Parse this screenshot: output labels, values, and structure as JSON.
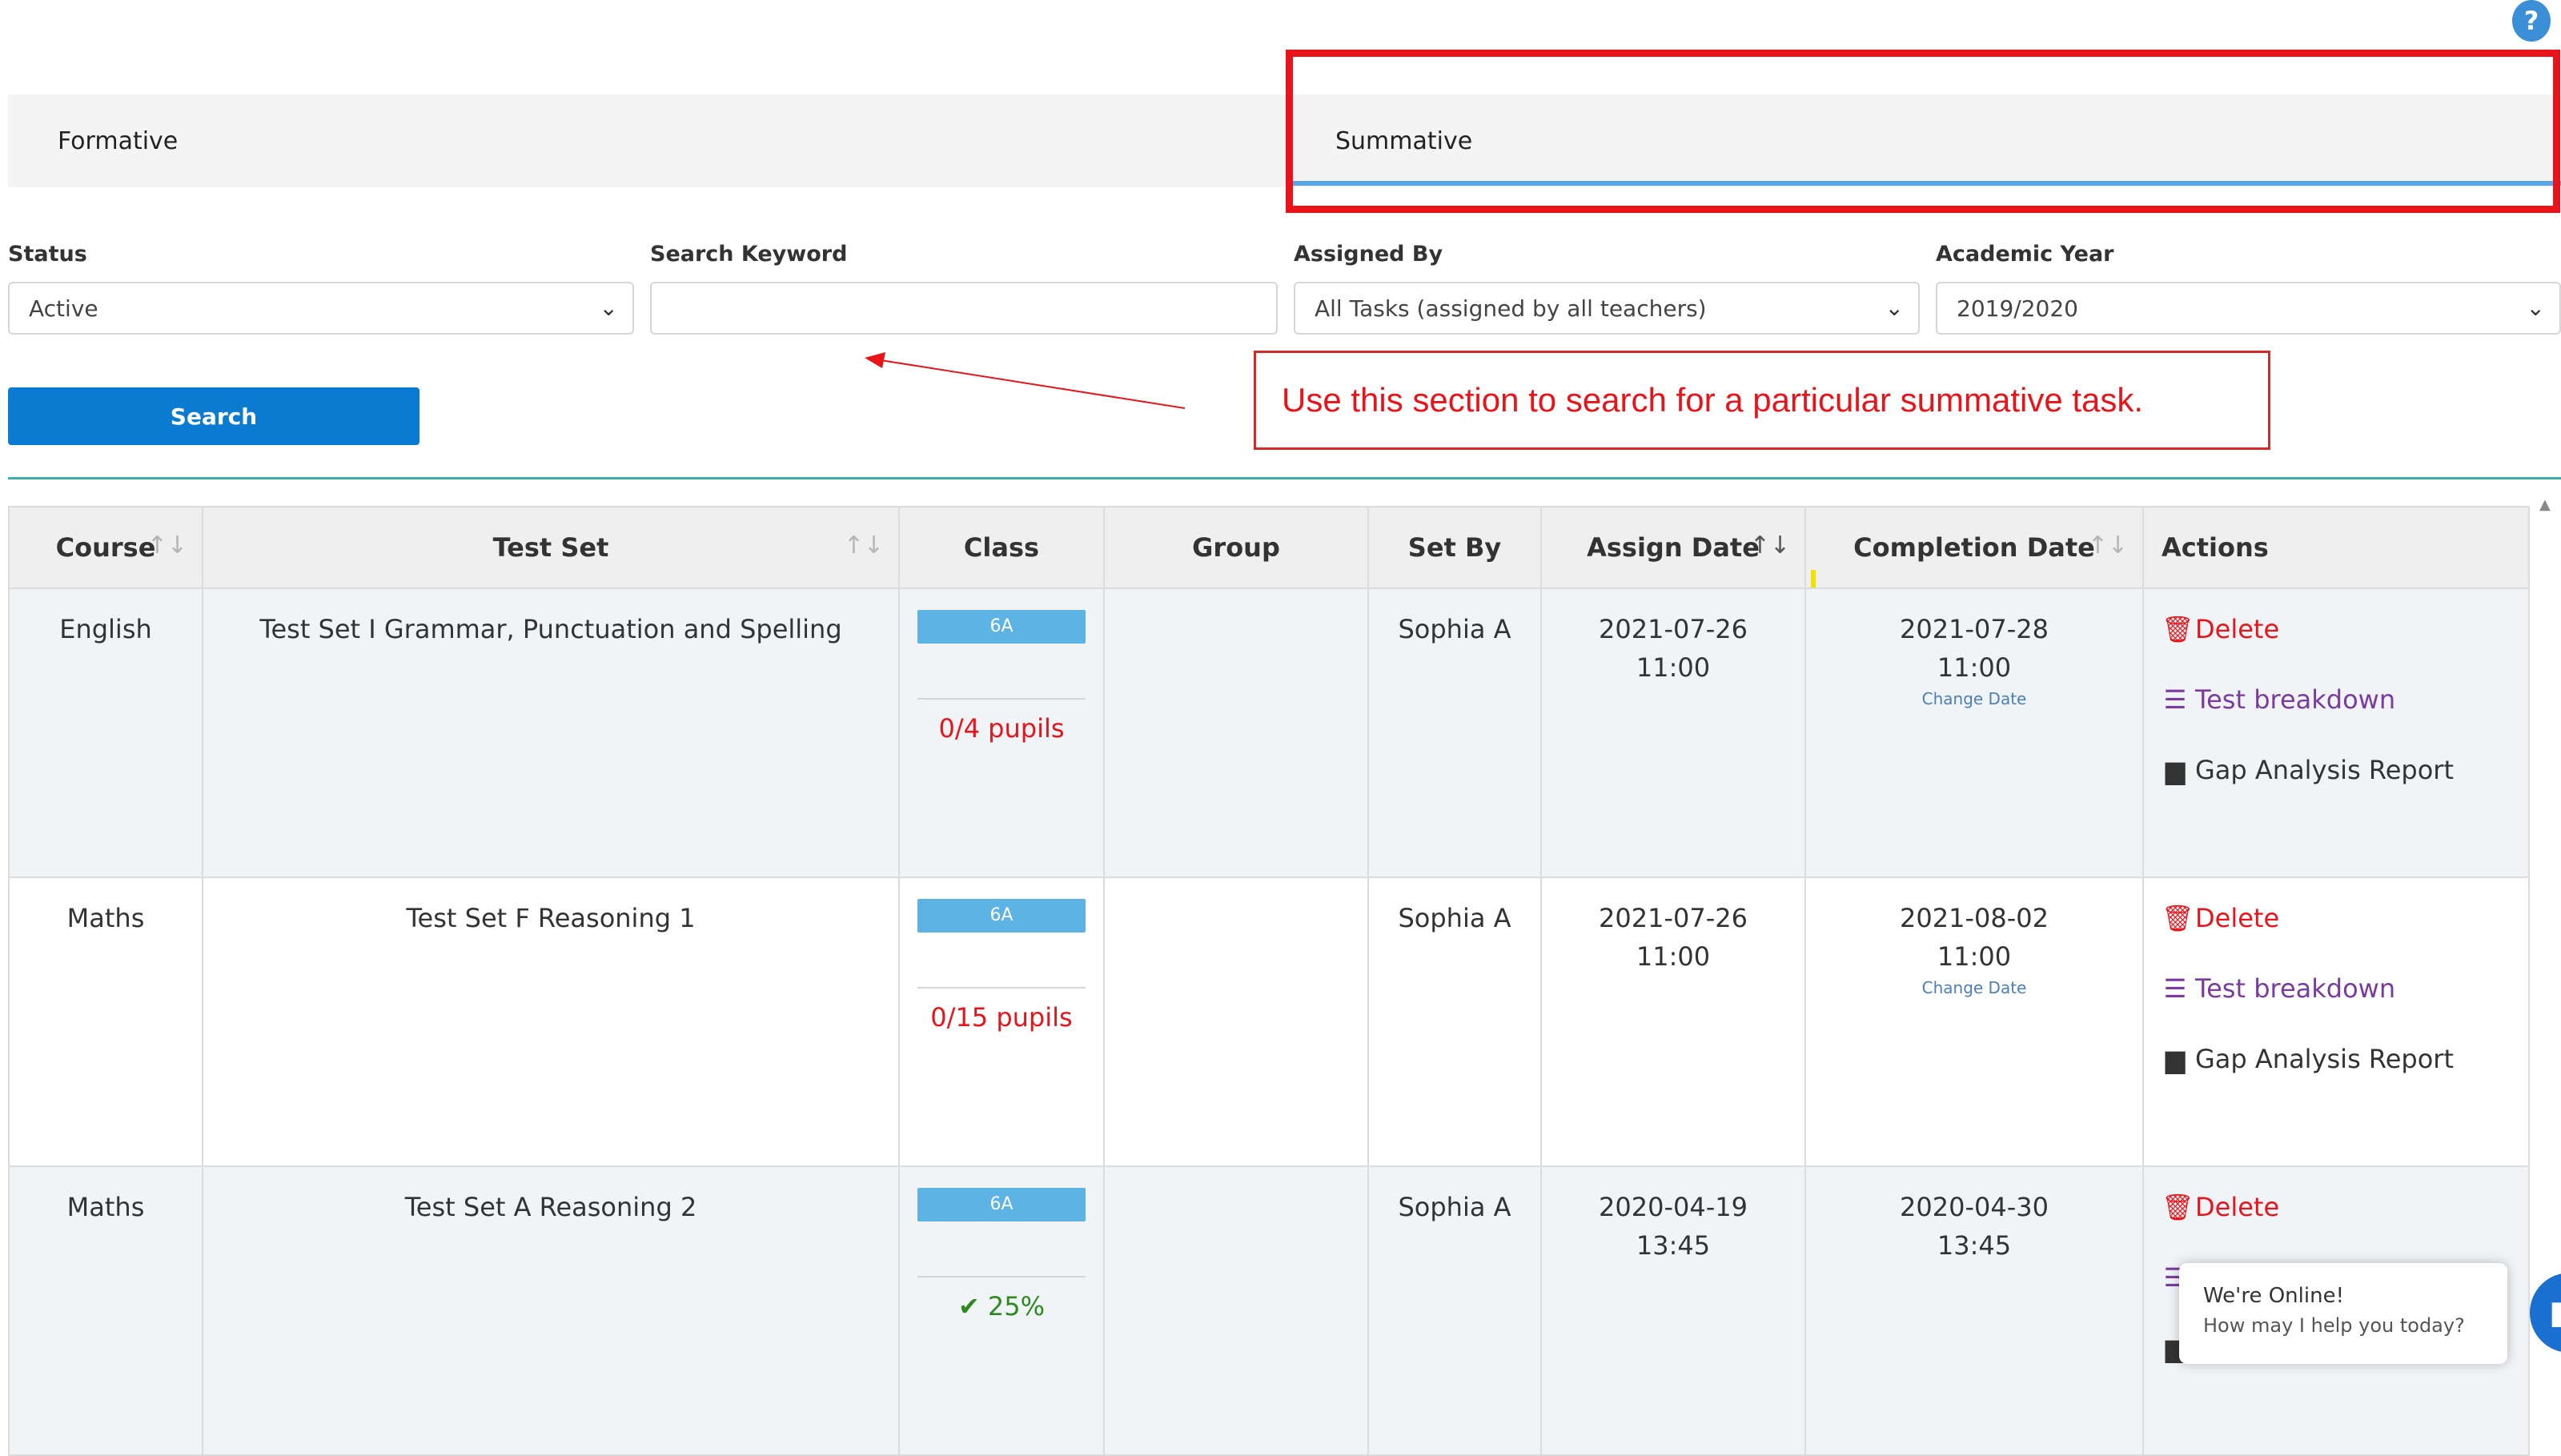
{
  "help": {
    "label": "?"
  },
  "tabs": {
    "formative": "Formative",
    "summative": "Summative"
  },
  "filters": {
    "status_label": "Status",
    "status_value": "Active",
    "keyword_label": "Search Keyword",
    "keyword_value": "",
    "assigned_label": "Assigned By",
    "assigned_value": "All Tasks (assigned by all teachers)",
    "year_label": "Academic Year",
    "year_value": "2019/2020",
    "search_button": "Search"
  },
  "annotation": {
    "text": "Use this section to search for a particular summative task."
  },
  "table": {
    "headers": {
      "course": "Course",
      "test_set": "Test Set",
      "class": "Class",
      "group": "Group",
      "set_by": "Set By",
      "assign_date": "Assign Date",
      "completion_date": "Completion Date",
      "actions": "Actions"
    },
    "rows": [
      {
        "course": "English",
        "test_set": "Test Set I Grammar, Punctuation and Spelling",
        "class": "6A",
        "progress": "0/4 pupils",
        "group": "",
        "set_by": "Sophia A",
        "assign_date": "2021-07-26",
        "assign_time": "11:00",
        "completion_date": "2021-07-28",
        "completion_time": "11:00",
        "change_date": "Change Date"
      },
      {
        "course": "Maths",
        "test_set": "Test Set F Reasoning 1",
        "class": "6A",
        "progress": "0/15 pupils",
        "group": "",
        "set_by": "Sophia A",
        "assign_date": "2021-07-26",
        "assign_time": "11:00",
        "completion_date": "2021-08-02",
        "completion_time": "11:00",
        "change_date": "Change Date"
      },
      {
        "course": "Maths",
        "test_set": "Test Set A Reasoning 2",
        "class": "6A",
        "progress": "25%",
        "group": "",
        "set_by": "Sophia A",
        "assign_date": "2020-04-19",
        "assign_time": "13:45",
        "completion_date": "2020-04-30",
        "completion_time": "13:45",
        "change_date": ""
      }
    ],
    "actions": {
      "delete": "Delete",
      "breakdown": "Test breakdown",
      "gap": "Gap Analysis Report"
    }
  },
  "chat": {
    "title": "We're Online!",
    "subtitle": "How may I help you today?"
  },
  "colors": {
    "accent": "#0a7bd0",
    "annotation_red": "#e8141a",
    "badge": "#5db3e4",
    "breakdown": "#7a3aa0",
    "success": "#2d8a1e"
  }
}
